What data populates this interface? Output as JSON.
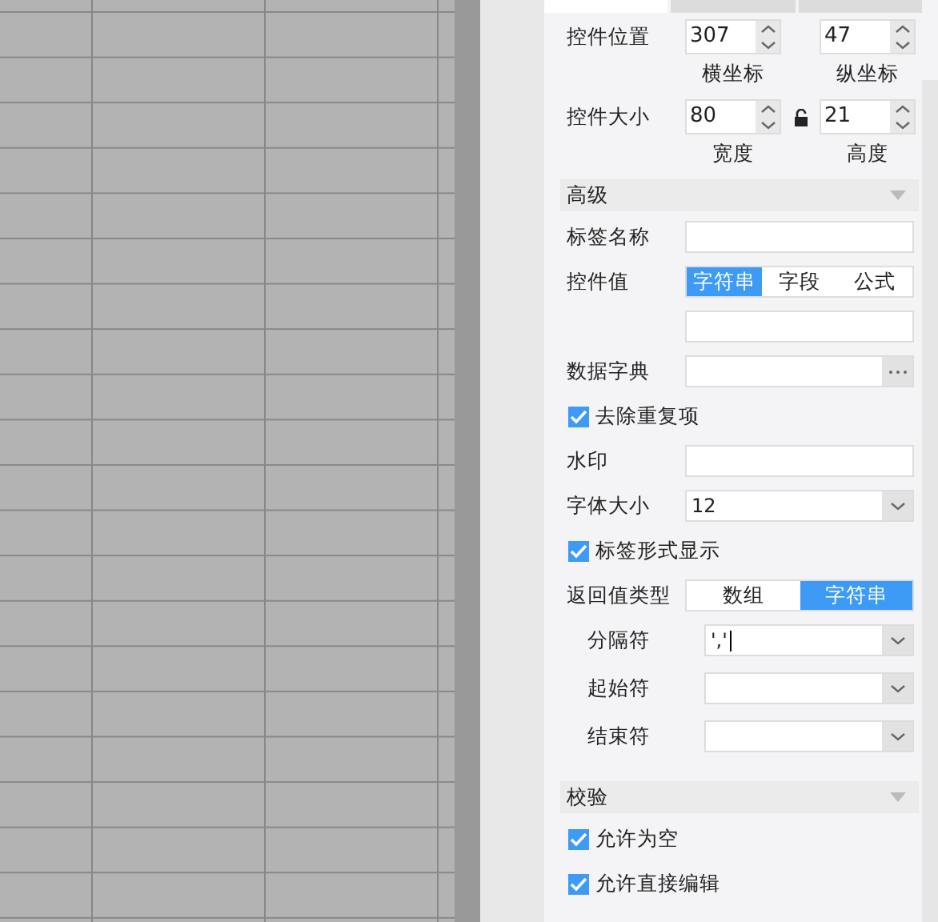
{
  "tabs": [
    {
      "selected": true
    },
    {
      "selected": false
    },
    {
      "selected": false
    }
  ],
  "position": {
    "label": "控件位置",
    "x": {
      "value": "307",
      "caption": "横坐标"
    },
    "y": {
      "value": "47",
      "caption": "纵坐标"
    }
  },
  "size": {
    "label": "控件大小",
    "locked": false,
    "width": {
      "value": "80",
      "caption": "宽度"
    },
    "height": {
      "value": "21",
      "caption": "高度"
    }
  },
  "sections": [
    {
      "title": "高级",
      "expanded": true,
      "rows": [
        {
          "kind": "text",
          "label": "标签名称"
        },
        {
          "kind": "segmented",
          "label": "控件值",
          "options": [
            {
              "label": "字符串",
              "selected": true
            },
            {
              "label": "字段",
              "selected": false
            },
            {
              "label": "公式",
              "selected": false
            }
          ]
        },
        {
          "kind": "text"
        },
        {
          "kind": "picker",
          "label": "数据字典"
        },
        {
          "kind": "checkbox",
          "label": "去除重复项",
          "checked": true
        },
        {
          "kind": "text",
          "label": "水印"
        },
        {
          "kind": "select",
          "label": "字体大小",
          "value": "12"
        },
        {
          "kind": "checkbox",
          "label": "标签形式显示",
          "checked": true
        },
        {
          "kind": "segmented",
          "label": "返回值类型",
          "options": [
            {
              "label": "数组",
              "selected": false
            },
            {
              "label": "字符串",
              "selected": true
            }
          ],
          "children": [
            {
              "kind": "select",
              "label": "分隔符",
              "value": "','",
              "focused": true
            },
            {
              "kind": "select",
              "label": "起始符"
            },
            {
              "kind": "select",
              "label": "结束符"
            }
          ]
        }
      ]
    },
    {
      "title": "校验",
      "expanded": true,
      "rows": [
        {
          "kind": "checkbox",
          "label": "允许为空",
          "checked": true
        },
        {
          "kind": "checkbox",
          "label": "允许直接编辑",
          "checked": true
        }
      ]
    }
  ]
}
